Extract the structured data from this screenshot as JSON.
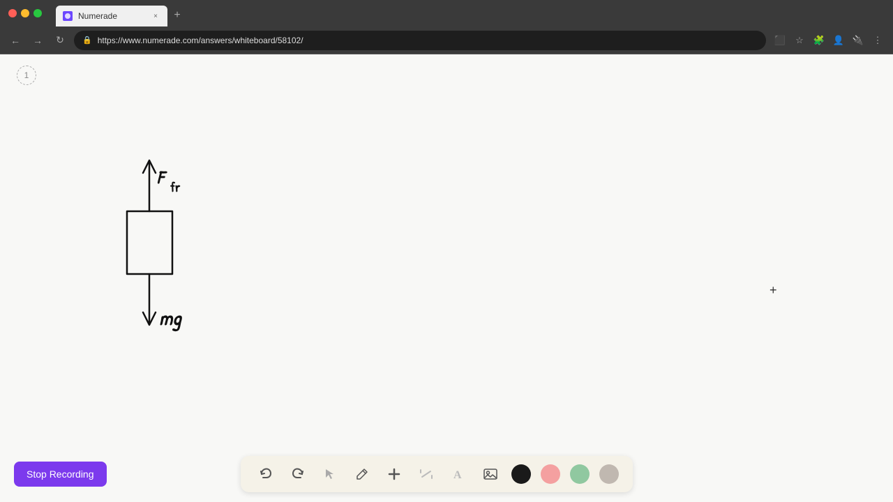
{
  "browser": {
    "traffic_lights": [
      "red",
      "yellow",
      "green"
    ],
    "tab": {
      "title": "Numerade",
      "favicon_color": "#6c47ff"
    },
    "url": "https://www.numerade.com/answers/whiteboard/58102/",
    "new_tab_label": "+"
  },
  "nav": {
    "back": "←",
    "forward": "→",
    "refresh": "↻",
    "lock_icon": "🔒"
  },
  "page": {
    "number": "1"
  },
  "cursor": {
    "symbol": "+"
  },
  "toolbar": {
    "undo_label": "↺",
    "redo_label": "↻",
    "select_label": "▷",
    "pen_label": "✏",
    "plus_label": "+",
    "slash_label": "/",
    "text_label": "A",
    "image_label": "⬜",
    "colors": [
      "black",
      "pink",
      "mint",
      "gray"
    ]
  },
  "recording": {
    "button_label": "Stop Recording"
  },
  "drawing": {
    "description": "Free body diagram with box, upward arrow labeled Ffr, downward arrow labeled mg"
  }
}
